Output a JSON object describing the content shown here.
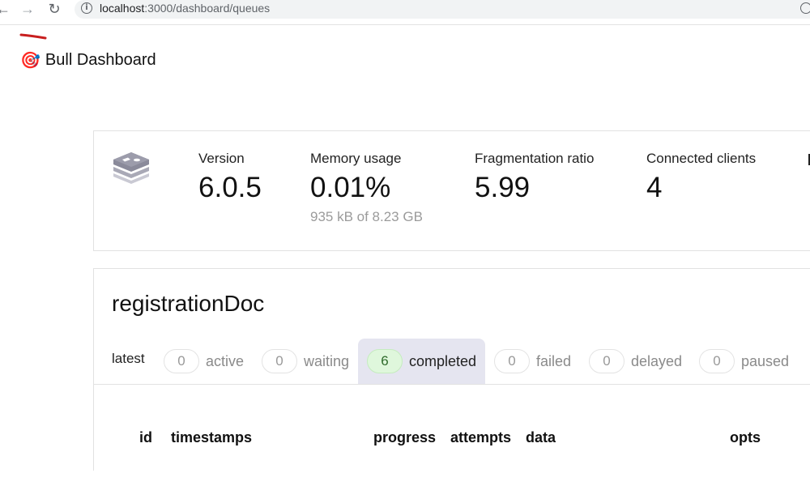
{
  "browser": {
    "back_glyph": "←",
    "forward_glyph": "→",
    "reload_glyph": "↻",
    "url_host": "localhost",
    "url_rest": ":3000/dashboard/queues"
  },
  "header": {
    "logo_emoji": "🎯",
    "title": "Bull Dashboard"
  },
  "redis": {
    "stats": [
      {
        "label": "Version",
        "value": "6.0.5",
        "sub": ""
      },
      {
        "label": "Memory usage",
        "value": "0.01%",
        "sub": "935 kB of 8.23 GB"
      },
      {
        "label": "Fragmentation ratio",
        "value": "5.99",
        "sub": ""
      },
      {
        "label": "Connected clients",
        "value": "4",
        "sub": ""
      }
    ]
  },
  "queue": {
    "name": "registrationDoc",
    "latest_label": "latest",
    "tabs": [
      {
        "count": "0",
        "label": "active"
      },
      {
        "count": "0",
        "label": "waiting"
      },
      {
        "count": "6",
        "label": "completed",
        "selected": true
      },
      {
        "count": "0",
        "label": "failed"
      },
      {
        "count": "0",
        "label": "delayed"
      },
      {
        "count": "0",
        "label": "paused"
      }
    ],
    "columns": [
      "id",
      "timestamps",
      "progress",
      "attempts",
      "data",
      "opts"
    ]
  },
  "colors": {
    "selected_tab_bg": "#e5e5f0",
    "completed_pill_bg": "#dff7dc",
    "scribble": "#c81e1e",
    "redis_logo": "#8a8a9a"
  }
}
